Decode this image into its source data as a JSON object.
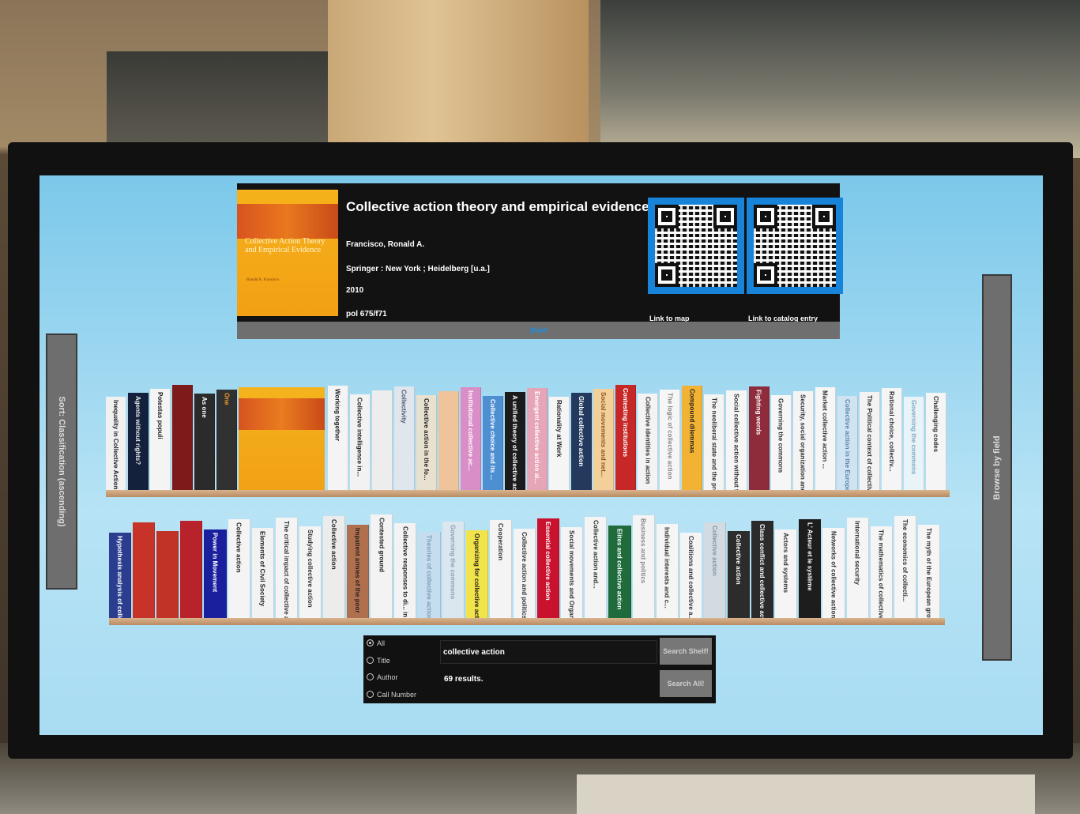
{
  "selected_book": {
    "title": "Collective action theory and empirical evidence",
    "author": "Francisco, Ronald A.",
    "publisher": "Springer : New York ; Heidelberg [u.a.]",
    "year": "2010",
    "call_number": "pol 675/f71",
    "cover_title": "Collective Action Theory and Empirical Evidence",
    "cover_author": "Ronald A. Francisco",
    "qr_map_label": "Link to map",
    "qr_catalog_label": "Link to catalog entry",
    "shelf_tab_label": "Shelf"
  },
  "side_tabs": {
    "left_label": "Sort: Classification (ascending)",
    "right_label": "Browse by field"
  },
  "shelf_top": [
    {
      "label": "Inequality in Collective Action Problems",
      "color": "#f1f1f1",
      "text": "#222"
    },
    {
      "label": "Agents without rights?",
      "color": "#14213d",
      "text": "#e6e6e6"
    },
    {
      "label": "Potestas populi",
      "color": "#f4f4f4",
      "text": "#222"
    },
    {
      "label": "",
      "color": "#7d1b1b",
      "text": "#fff"
    },
    {
      "label": "As one",
      "color": "#2b2b2b",
      "text": "#fff"
    },
    {
      "label": "One",
      "color": "#313131",
      "text": "#f29a2e"
    },
    {
      "label": "Working together",
      "color": "#f4f4f4",
      "text": "#222"
    },
    {
      "label": "Collective intelligence in...",
      "color": "#f2f2f2",
      "text": "#222"
    },
    {
      "label": "",
      "color": "#ededed",
      "text": "#222"
    },
    {
      "label": "Collectivity",
      "color": "#dfe6ee",
      "text": "#556"
    },
    {
      "label": "Collective action in the fo...",
      "color": "#e9e1cf",
      "text": "#222"
    },
    {
      "label": "",
      "color": "#f0c49a",
      "text": "#222"
    },
    {
      "label": "Institutional collective ac...",
      "color": "#d98ec7",
      "text": "#fff"
    },
    {
      "label": "Collective choice and its ...",
      "color": "#4e8fd1",
      "text": "#fff"
    },
    {
      "label": "A unified theory of collective act...",
      "color": "#1b1b1b",
      "text": "#fff"
    },
    {
      "label": "Emergent collective action al...",
      "color": "#e7a5b8",
      "text": "#fff"
    },
    {
      "label": "Rationality at Work",
      "color": "#f5f5f5",
      "text": "#222"
    },
    {
      "label": "Global collective action",
      "color": "#233a5e",
      "text": "#fff"
    },
    {
      "label": "Social movements and net...",
      "color": "#f3cf9a",
      "text": "#8a5a22"
    },
    {
      "label": "Contesting institutions",
      "color": "#c62828",
      "text": "#fff"
    },
    {
      "label": "Collective identities in action",
      "color": "#f3f3f3",
      "text": "#333"
    },
    {
      "label": "The logic of collective action",
      "color": "#f6f6f6",
      "text": "#888"
    },
    {
      "label": "Compound dilemmas",
      "color": "#f2b233",
      "text": "#222"
    },
    {
      "label": "The neoliberal state and the prospects of collecti...",
      "color": "#f4f4f4",
      "text": "#333"
    },
    {
      "label": "Social collective action without firm ...",
      "color": "#f6f6f6",
      "text": "#333"
    },
    {
      "label": "Fighting words",
      "color": "#8e2c3c",
      "text": "#fff"
    },
    {
      "label": "Governing the commons",
      "color": "#f6f6f6",
      "text": "#333"
    },
    {
      "label": "Security, social organization and collective action ...",
      "color": "#f4f4f4",
      "text": "#333"
    },
    {
      "label": "Market collective action ...",
      "color": "#f6f6f6",
      "text": "#333"
    },
    {
      "label": "Collective action in the European Union",
      "color": "#cfe3f1",
      "text": "#5a86b0"
    },
    {
      "label": "The Political context of collective action",
      "color": "#f3f3f3",
      "text": "#333"
    },
    {
      "label": "Rational choice, collectiv...",
      "color": "#f5f5f5",
      "text": "#333"
    },
    {
      "label": "Governing the commons",
      "color": "#e9f4f8",
      "text": "#7fa8c0"
    },
    {
      "label": "Challenging codes",
      "color": "#f5f5f5",
      "text": "#333"
    }
  ],
  "shelf_bottom": [
    {
      "label": "Hypothesis analysis of collectiv...",
      "color": "#2b3d8f",
      "text": "#fff"
    },
    {
      "label": "",
      "color": "#c73328",
      "text": "#fff"
    },
    {
      "label": "",
      "color": "#c13327",
      "text": "#fff"
    },
    {
      "label": "",
      "color": "#b8222b",
      "text": "#fff"
    },
    {
      "label": "Power in Movement",
      "color": "#1a1f9e",
      "text": "#fff"
    },
    {
      "label": "Collective action",
      "color": "#f4f4f4",
      "text": "#222"
    },
    {
      "label": "Elements of Civil Society",
      "color": "#f2f2f2",
      "text": "#222"
    },
    {
      "label": "The critical impact of collective action",
      "color": "#f4f4f4",
      "text": "#333"
    },
    {
      "label": "Studying collective action",
      "color": "#f4f4f4",
      "text": "#333"
    },
    {
      "label": "Collective action",
      "color": "#ececec",
      "text": "#222"
    },
    {
      "label": "Impatient armies of the poor",
      "color": "#b0704d",
      "text": "#222"
    },
    {
      "label": "Contested ground",
      "color": "#f3f3f3",
      "text": "#222"
    },
    {
      "label": "Collective responses to di... in international...",
      "color": "#f3f3f3",
      "text": "#222"
    },
    {
      "label": "Theories of collective action",
      "color": "#c6ddef",
      "text": "#7b9db8"
    },
    {
      "label": "Governing the commons",
      "color": "#dbe7ef",
      "text": "#8aa1b2"
    },
    {
      "label": "Organizing for collective action",
      "color": "#f1e34a",
      "text": "#222"
    },
    {
      "label": "Cooperation",
      "color": "#f4f4f4",
      "text": "#333"
    },
    {
      "label": "Collective action and politics",
      "color": "#f4f4f4",
      "text": "#333"
    },
    {
      "label": "Essential collective action",
      "color": "#c8122e",
      "text": "#fff"
    },
    {
      "label": "Social movements and Organizing",
      "color": "#f4f4f4",
      "text": "#333"
    },
    {
      "label": "Collective action and...",
      "color": "#f4f4f4",
      "text": "#333"
    },
    {
      "label": "Elites and collective action",
      "color": "#1f6b3b",
      "text": "#fff"
    },
    {
      "label": "Business and politics",
      "color": "#f4f4f4",
      "text": "#888"
    },
    {
      "label": "Individual interests and c...",
      "color": "#f5f5f5",
      "text": "#333"
    },
    {
      "label": "Coalitions and collective a...",
      "color": "#f5f5f5",
      "text": "#333"
    },
    {
      "label": "Collective action",
      "color": "#d2dbe2",
      "text": "#8093a4"
    },
    {
      "label": "Collective action",
      "color": "#2c2c2c",
      "text": "#fff"
    },
    {
      "label": "Class conflict and collective action",
      "color": "#2b2b2b",
      "text": "#fff"
    },
    {
      "label": "Actors and systems",
      "color": "#f5f5f5",
      "text": "#333"
    },
    {
      "label": "L' Acteur et le système",
      "color": "#1d1d1d",
      "text": "#fff"
    },
    {
      "label": "Networks of collective action",
      "color": "#f5f5f5",
      "text": "#333"
    },
    {
      "label": "International security",
      "color": "#f5f5f5",
      "text": "#333"
    },
    {
      "label": "The mathematics of collective action",
      "color": "#f5f5f5",
      "text": "#333"
    },
    {
      "label": "The economics of collecti...",
      "color": "#f5f5f5",
      "text": "#333"
    },
    {
      "label": "The myth of the European growth",
      "color": "#f5f5f5",
      "text": "#333"
    }
  ],
  "search": {
    "options": [
      "All",
      "Title",
      "Author",
      "Call Number"
    ],
    "selected": "All",
    "query": "collective action",
    "results_text": "69 results.",
    "search_shelf_label": "Search Shelf!",
    "search_all_label": "Search All!"
  }
}
